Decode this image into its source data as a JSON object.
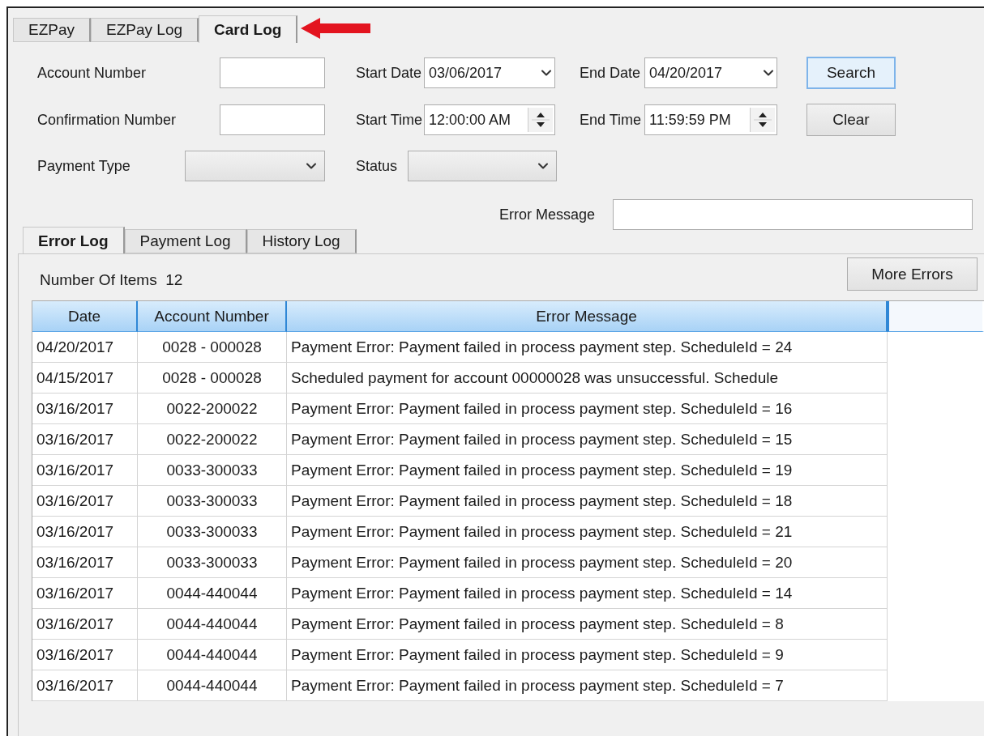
{
  "tabs": [
    {
      "label": "EZPay",
      "selected": false
    },
    {
      "label": "EZPay Log",
      "selected": false
    },
    {
      "label": "Card Log",
      "selected": true
    }
  ],
  "filters": {
    "account_number": {
      "label": "Account Number"
    },
    "confirmation_number": {
      "label": "Confirmation Number"
    },
    "payment_type": {
      "label": "Payment Type"
    },
    "start_date": {
      "label": "Start Date",
      "value": "03/06/2017"
    },
    "start_time": {
      "label": "Start Time",
      "value": "12:00:00 AM"
    },
    "status": {
      "label": "Status"
    },
    "end_date": {
      "label": "End Date",
      "value": "04/20/2017"
    },
    "end_time": {
      "label": "End Time",
      "value": "11:59:59 PM"
    },
    "error_message": {
      "label": "Error Message"
    }
  },
  "buttons": [
    {
      "label": "Search",
      "focused": true
    },
    {
      "label": "Clear",
      "focused": false
    }
  ],
  "log_tabs": [
    {
      "label": "Error Log",
      "selected": true
    },
    {
      "label": "Payment Log",
      "selected": false
    },
    {
      "label": "History Log",
      "selected": false
    }
  ],
  "count": {
    "label": "Number Of Items",
    "value": "12"
  },
  "more_button": "More Errors",
  "table": {
    "columns": [
      "Date",
      "Account Number",
      "Error Message"
    ],
    "rows": [
      [
        "04/20/2017",
        "0028 - 000028",
        "Payment Error: Payment failed in process payment step. ScheduleId = 24"
      ],
      [
        "04/15/2017",
        "0028 - 000028",
        "Scheduled payment for account 00000028 was unsuccessful. Schedule"
      ],
      [
        "03/16/2017",
        "0022-200022",
        "Payment Error: Payment failed in process payment step. ScheduleId = 16"
      ],
      [
        "03/16/2017",
        "0022-200022",
        "Payment Error: Payment failed in process payment step. ScheduleId = 15"
      ],
      [
        "03/16/2017",
        "0033-300033",
        "Payment Error: Payment failed in process payment step. ScheduleId = 19"
      ],
      [
        "03/16/2017",
        "0033-300033",
        "Payment Error: Payment failed in process payment step. ScheduleId = 18"
      ],
      [
        "03/16/2017",
        "0033-300033",
        "Payment Error: Payment failed in process payment step. ScheduleId = 21"
      ],
      [
        "03/16/2017",
        "0033-300033",
        "Payment Error: Payment failed in process payment step. ScheduleId = 20"
      ],
      [
        "03/16/2017",
        "0044-440044",
        "Payment Error: Payment failed in process payment step. ScheduleId = 14"
      ],
      [
        "03/16/2017",
        "0044-440044",
        "Payment Error: Payment failed in process payment step. ScheduleId = 8"
      ],
      [
        "03/16/2017",
        "0044-440044",
        "Payment Error: Payment failed in process payment step. ScheduleId = 9"
      ],
      [
        "03/16/2017",
        "0044-440044",
        "Payment Error: Payment failed in process payment step. ScheduleId = 7"
      ]
    ]
  }
}
